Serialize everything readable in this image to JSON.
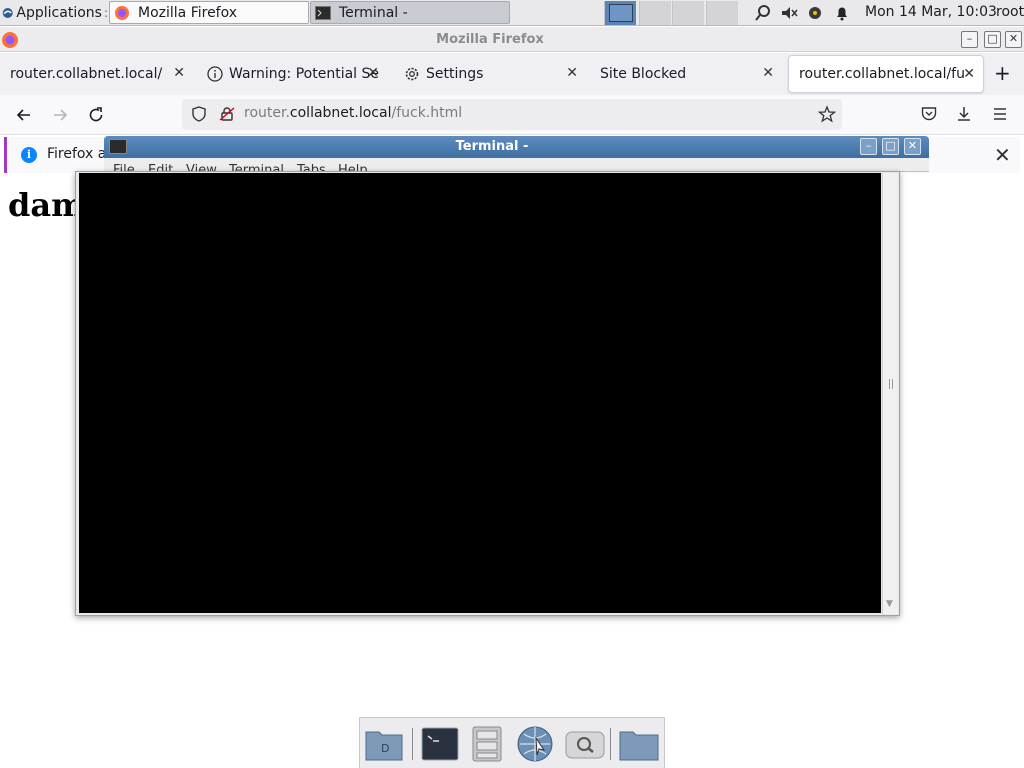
{
  "panel": {
    "applications_label": "Applications",
    "applications_suffix": ":",
    "tasks": [
      {
        "label": "Mozilla Firefox"
      },
      {
        "label": "Terminal -"
      }
    ],
    "clock": "Mon 14 Mar, 10:03",
    "user": "root"
  },
  "firefox": {
    "window_title": "Mozilla Firefox",
    "tabs": [
      {
        "label": "router.collabnet.local/"
      },
      {
        "label": "Warning: Potential Se"
      },
      {
        "label": "Settings"
      },
      {
        "label": "Site Blocked"
      },
      {
        "label": "router.collabnet.local/fu"
      }
    ],
    "url": {
      "prefix": "router.",
      "host": "collabnet.local",
      "path": "/fuck.html"
    },
    "notification_text": "Firefox a",
    "page_heading": "dam",
    "accent_color": "#0a84ff"
  },
  "terminal": {
    "title": "Terminal -",
    "menu": [
      "File",
      "Edit",
      "View",
      "Terminal",
      "Tabs",
      "Help"
    ],
    "background": "#000000"
  },
  "dock": {
    "items": [
      "desktop-icon",
      "terminal-icon",
      "file-cabinet-icon",
      "web-browser-icon",
      "search-icon",
      "folder-icon"
    ]
  }
}
